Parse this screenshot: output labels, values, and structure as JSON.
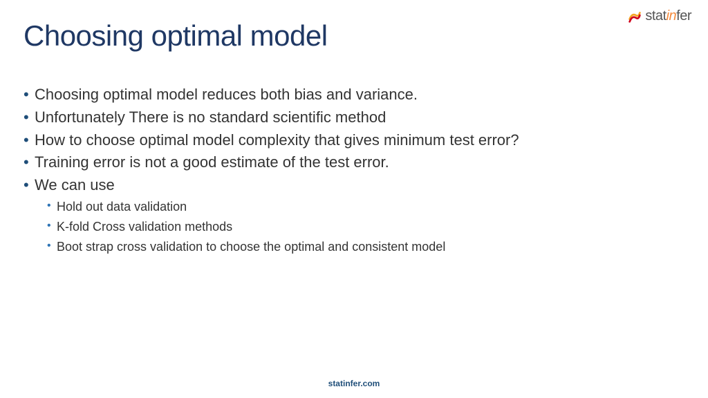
{
  "logo": {
    "part1": "stat",
    "part2": "in",
    "part3": "fer"
  },
  "title": "Choosing optimal model",
  "bullets": [
    {
      "text": "Choosing optimal model reduces both bias and variance."
    },
    {
      "text": "Unfortunately There is no standard scientific method"
    },
    {
      "text": "How to choose optimal model complexity that gives minimum test error?"
    },
    {
      "text": "Training error is not a good estimate of the test error."
    },
    {
      "text": "We can use"
    }
  ],
  "subbullets": [
    {
      "text": "Hold out data validation"
    },
    {
      "text": "K-fold Cross validation methods"
    },
    {
      "text": "Boot strap cross validation to choose the optimal and consistent model"
    }
  ],
  "footer": "statinfer.com"
}
